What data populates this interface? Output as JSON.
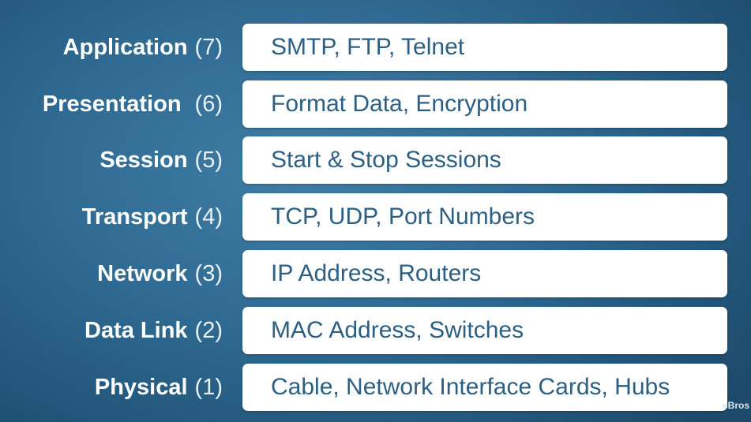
{
  "layers": [
    {
      "name": "Application",
      "number": "(7)",
      "description": "SMTP, FTP, Telnet"
    },
    {
      "name": "Presentation",
      "number": "(6)",
      "description": "Format Data, Encryption"
    },
    {
      "name": "Session",
      "number": "(5)",
      "description": "Start & Stop Sessions"
    },
    {
      "name": "Transport",
      "number": "(4)",
      "description": "TCP, UDP, Port Numbers"
    },
    {
      "name": "Network",
      "number": "(3)",
      "description": "IP Address, Routers"
    },
    {
      "name": "Data Link",
      "number": "(2)",
      "description": "MAC Address, Switches"
    },
    {
      "name": "Physical",
      "number": "(1)",
      "description": "Cable, Network Interface Cards, Hubs"
    }
  ],
  "watermark": "eBros",
  "colors": {
    "background": "#2f6a92",
    "box_fill": "#ffffff",
    "box_text": "#2b5f83",
    "label_text": "#ffffff"
  }
}
